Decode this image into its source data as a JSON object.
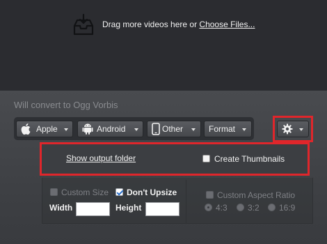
{
  "dropzone": {
    "icon": "inbox-tray-icon",
    "prompt_text": "Drag more videos here or ",
    "choose_link": "Choose Files..."
  },
  "convert_label": "Will convert to Ogg Vorbis",
  "toolbar": {
    "apple": {
      "label": "Apple",
      "icon": "apple-icon"
    },
    "android": {
      "label": "Android",
      "icon": "android-icon"
    },
    "other": {
      "label": "Other",
      "icon": "phone-icon"
    },
    "format": {
      "label": "Format"
    },
    "settings": {
      "icon": "gear-icon"
    }
  },
  "options": {
    "show_output_folder": "Show output folder",
    "create_thumbnails": {
      "label": "Create Thumbnails",
      "checked": false
    }
  },
  "size": {
    "custom_size": {
      "label": "Custom Size",
      "checked": false,
      "enabled": false
    },
    "dont_upsize": {
      "label": "Don't Upsize",
      "checked": true
    },
    "width_label": "Width",
    "height_label": "Height",
    "width_value": "",
    "height_value": ""
  },
  "aspect": {
    "custom_aspect": {
      "label": "Custom Aspect Ratio",
      "checked": false,
      "enabled": false
    },
    "ratios": [
      "4:3",
      "3:2",
      "16:9"
    ],
    "selected": "4:3"
  },
  "colors": {
    "highlight": "#e0262b",
    "dropzone_bg": "#2b2c30",
    "panel_bg": "#46484c"
  }
}
